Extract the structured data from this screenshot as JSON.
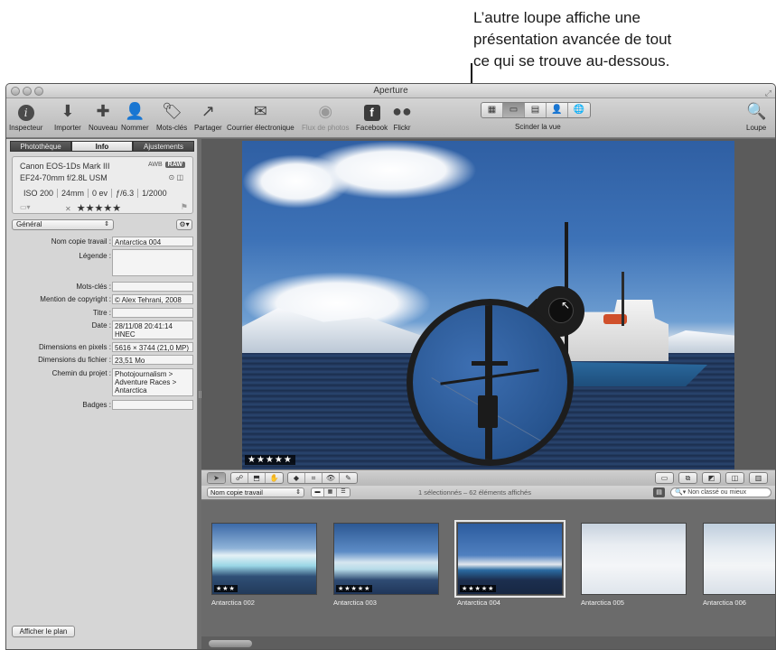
{
  "annotation": {
    "line1": "L’autre loupe affiche une",
    "line2": "présentation avancée de tout",
    "line3": "ce qui se trouve au-dessous."
  },
  "window": {
    "title": "Aperture"
  },
  "toolbar": {
    "inspecteur": "Inspecteur",
    "importer": "Importer",
    "nouveau": "Nouveau",
    "nommer": "Nommer",
    "mots_cles": "Mots-clés",
    "partager": "Partager",
    "courrier": "Courrier électronique",
    "flux": "Flux de photos",
    "facebook": "Facebook",
    "flickr": "Flickr",
    "scinder": "Scinder la vue",
    "loupe": "Loupe"
  },
  "tabs": {
    "phototheque": "Photothèque",
    "info": "Info",
    "ajustements": "Ajustements"
  },
  "camera": {
    "model": "Canon EOS-1Ds Mark III",
    "lens": "EF24-70mm f/2.8L USM",
    "awb": "AWB",
    "raw": "RAW",
    "iso": "ISO 200",
    "focal": "24mm",
    "ev": "0 ev",
    "aperture": "ƒ/6.3",
    "shutter": "1/2000",
    "rating": "★★★★★"
  },
  "preset": {
    "value": "Général"
  },
  "metadata": {
    "nom_label": "Nom copie travail :",
    "nom_value": "Antarctica 004",
    "legende_label": "Légende :",
    "mots_label": "Mots-clés :",
    "copyright_label": "Mention de copyright :",
    "copyright_value": "© Alex Tehrani, 2008",
    "titre_label": "Titre :",
    "date_label": "Date :",
    "date_value": "28/11/08 20:41:14 HNEC",
    "dimpix_label": "Dimensions en pixels :",
    "dimpix_value": "5616 × 3744 (21,0 MP)",
    "dimfile_label": "Dimensions du fichier :",
    "dimfile_value": "23,51 Mo",
    "chemin_label": "Chemin du projet :",
    "chemin_value": "Photojournalism > Adventure Races > Antarctica",
    "badges_label": "Badges :"
  },
  "afficher_plan": "Afficher le plan",
  "viewer": {
    "stars": "★★★★★"
  },
  "browser": {
    "sort": "Nom copie travail",
    "status": "1 sélectionnés – 62 éléments affichés",
    "search_placeholder": "Non classé ou mieux"
  },
  "thumbnails": [
    {
      "label": "Antarctica 002",
      "stars": "★★★"
    },
    {
      "label": "Antarctica 003",
      "stars": "★★★★★"
    },
    {
      "label": "Antarctica 004",
      "stars": "★★★★★"
    },
    {
      "label": "Antarctica 005",
      "stars": ""
    },
    {
      "label": "Antarctica 006",
      "stars": ""
    }
  ]
}
